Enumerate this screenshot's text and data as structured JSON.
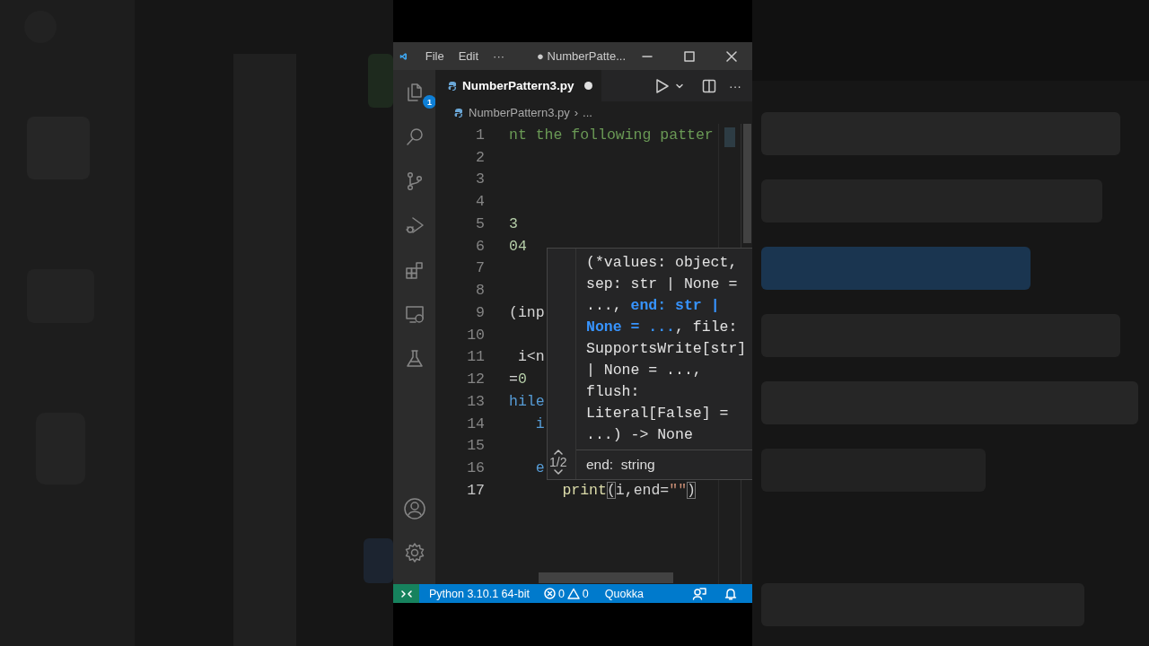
{
  "title_bar": {
    "menus": [
      "File",
      "Edit"
    ],
    "more": "···",
    "title": "● NumberPatte..."
  },
  "activity_bar": {
    "explorer_badge": "1"
  },
  "tab": {
    "label": "NumberPattern3.py",
    "selected": true,
    "modified": true
  },
  "tab_actions": {
    "more": "···"
  },
  "breadcrumb": {
    "file": "NumberPattern3.py",
    "separator": "›",
    "rest": "..."
  },
  "editor": {
    "lines": [
      {
        "number": "1",
        "active": false,
        "tokens": [
          {
            "text": "nt the following patter",
            "kind": "comment"
          }
        ]
      },
      {
        "number": "2",
        "active": false
      },
      {
        "number": "3",
        "active": false
      },
      {
        "number": "4",
        "active": false
      },
      {
        "number": "5",
        "active": false,
        "tokens": [
          {
            "text": "3",
            "kind": "number"
          }
        ]
      },
      {
        "number": "6",
        "active": false,
        "tokens": [
          {
            "text": "04",
            "kind": "number"
          }
        ]
      },
      {
        "number": "7",
        "active": false
      },
      {
        "number": "8",
        "active": false
      },
      {
        "number": "9",
        "active": false,
        "tokens": [
          {
            "text": "(inp",
            "kind": "plain"
          }
        ]
      },
      {
        "number": "10",
        "active": false
      },
      {
        "number": "11",
        "active": false,
        "tokens": [
          {
            "text": " i<n",
            "kind": "plain"
          }
        ]
      },
      {
        "number": "12",
        "active": false,
        "tokens": [
          {
            "text": "=",
            "kind": "plain"
          },
          {
            "text": "0",
            "kind": "number"
          }
        ]
      },
      {
        "number": "13",
        "active": false,
        "tokens": [
          {
            "text": "hile",
            "kind": "keyword"
          }
        ]
      },
      {
        "number": "14",
        "active": false,
        "tokens": [
          {
            "text": "   i",
            "kind": "keyword"
          }
        ]
      },
      {
        "number": "15",
        "active": false
      },
      {
        "number": "16",
        "active": false,
        "tokens": [
          {
            "text": "   e",
            "kind": "keyword"
          }
        ]
      },
      {
        "number": "17",
        "active": true,
        "tokens": [
          {
            "text": "      print",
            "kind": "function"
          },
          {
            "text": "(",
            "kind": "matched"
          },
          {
            "text": "i,end=",
            "kind": "plain"
          },
          {
            "text": "\"\"",
            "kind": "string"
          },
          {
            "text": ")",
            "kind": "matched"
          }
        ]
      }
    ]
  },
  "hover": {
    "signature": [
      [
        {
          "text": "(*values: object,",
          "highlight": false
        }
      ],
      [
        {
          "text": "sep: str | None =",
          "highlight": false
        }
      ],
      [
        {
          "text": "..., ",
          "highlight": false
        },
        {
          "text": "end: str |",
          "highlight": true
        }
      ],
      [
        {
          "text": "None = ...",
          "highlight": true
        },
        {
          "text": ", file:",
          "highlight": false
        }
      ],
      [
        {
          "text": "SupportsWrite[str]",
          "highlight": false
        }
      ],
      [
        {
          "text": "| None = ...,",
          "highlight": false
        }
      ],
      [
        {
          "text": "flush:",
          "highlight": false
        }
      ],
      [
        {
          "text": "Literal[False] =",
          "highlight": false
        }
      ],
      [
        {
          "text": "...) -> None",
          "highlight": false
        }
      ]
    ],
    "page": "1/2",
    "doc": "end:  string"
  },
  "status_bar": {
    "interpreter": "Python 3.10.1 64-bit",
    "errors": "0",
    "warnings": "0",
    "extension": "Quokka"
  }
}
